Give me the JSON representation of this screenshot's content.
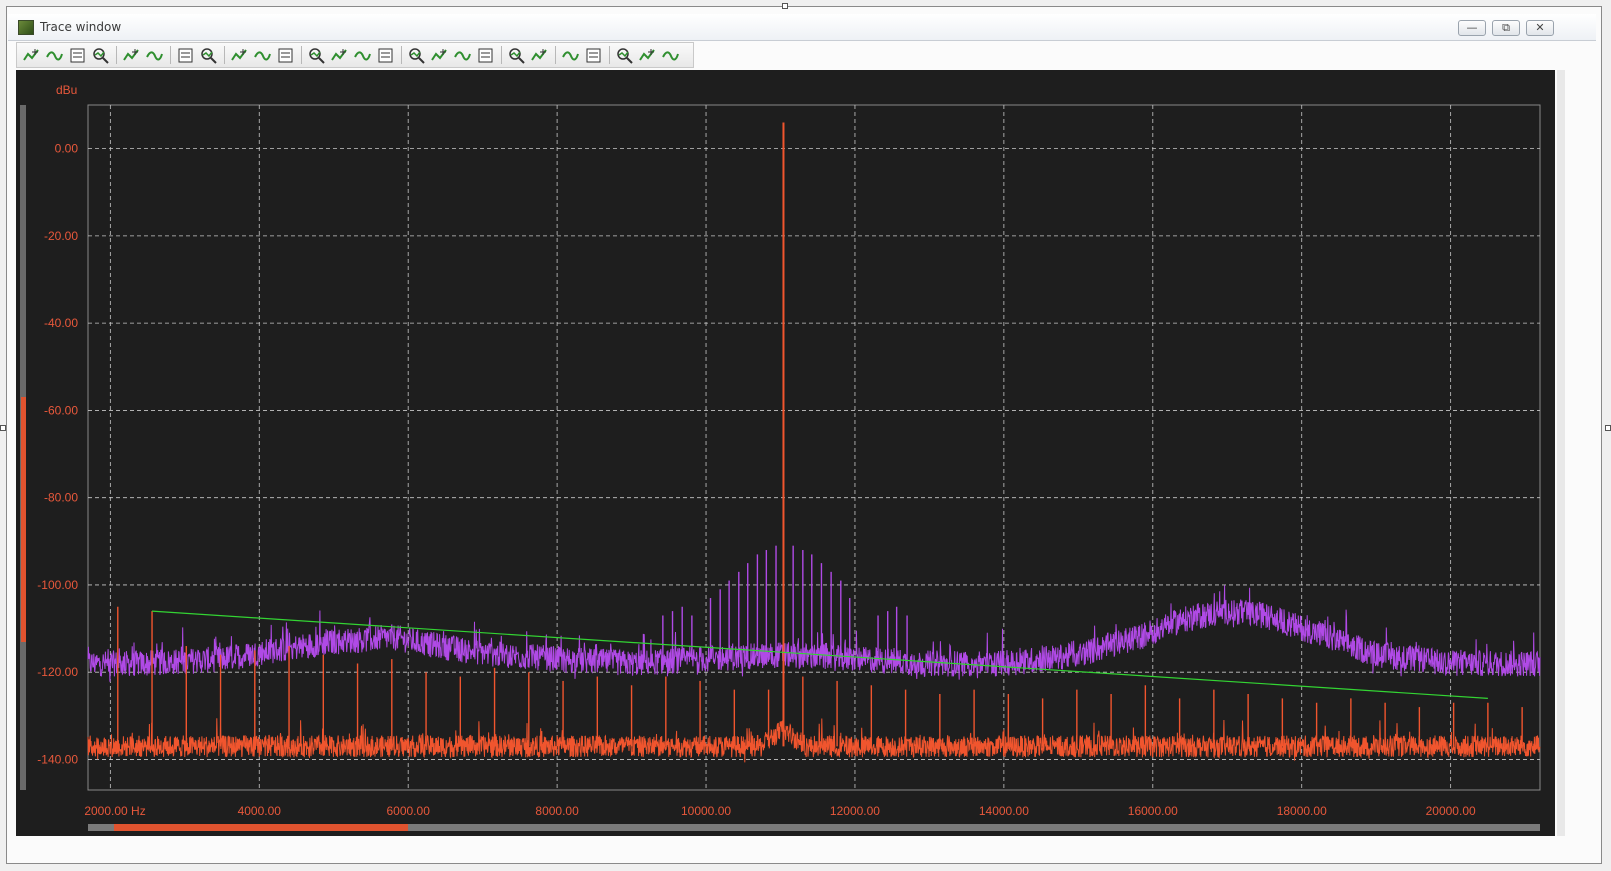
{
  "window": {
    "title": "Trace window"
  },
  "toolbar": {
    "icons": [
      "add-trace-icon",
      "wave-icon",
      "save-icon",
      "copy-icon",
      "grid-icon",
      "list-icon",
      "table-icon",
      "marker-icon",
      "zoom-in-icon",
      "zoom-out-icon",
      "fit-icon",
      "cursor-a-icon",
      "cursor-b-icon",
      "cursor-c-icon",
      "cursor-d-icon",
      "zoom-x-icon",
      "zoom-y-icon",
      "smooth-icon",
      "scale-icon",
      "peak-icon",
      "valley-icon",
      "measure-icon",
      "swap-icon",
      "hide-icon",
      "show-icon",
      "filter-icon"
    ]
  },
  "colors": {
    "background": "#1e1e1e",
    "grid": "#c8c8c8",
    "axis_text": "#e8583b",
    "trace_red": "#f0552e",
    "trace_purple": "#b04ae6",
    "trace_green": "#33d433"
  },
  "chart_data": {
    "type": "line",
    "ylabel": "dBu",
    "x_unit": "Hz",
    "xlim": [
      1700,
      21200
    ],
    "ylim": [
      -147,
      10
    ],
    "grid": true,
    "x_ticks": [
      2000,
      4000,
      6000,
      8000,
      10000,
      12000,
      14000,
      16000,
      18000,
      20000
    ],
    "x_tick_labels": [
      "2000.00 Hz",
      "4000.00",
      "6000.00",
      "8000.00",
      "10000.00",
      "12000.00",
      "14000.00",
      "16000.00",
      "18000.00",
      "20000.00"
    ],
    "y_ticks": [
      0,
      -20,
      -40,
      -60,
      -80,
      -100,
      -120,
      -140
    ],
    "y_tick_labels": [
      "0.00",
      "-20.00",
      "-40.00",
      "-60.00",
      "-80.00",
      "-100.00",
      "-120.00",
      "-140.00"
    ],
    "series": [
      {
        "color": "#f0552e",
        "noise_floor": -137,
        "peaks": [
          {
            "x": 2100,
            "y": -105
          },
          {
            "x": 2560,
            "y": -106
          },
          {
            "x": 3020,
            "y": -114
          },
          {
            "x": 3480,
            "y": -116
          },
          {
            "x": 3940,
            "y": -115
          },
          {
            "x": 4400,
            "y": -114
          },
          {
            "x": 4860,
            "y": -116
          },
          {
            "x": 5320,
            "y": -118
          },
          {
            "x": 5780,
            "y": -117
          },
          {
            "x": 6240,
            "y": -120
          },
          {
            "x": 6700,
            "y": -121
          },
          {
            "x": 7160,
            "y": -119
          },
          {
            "x": 7620,
            "y": -120
          },
          {
            "x": 8080,
            "y": -122
          },
          {
            "x": 8540,
            "y": -121
          },
          {
            "x": 9000,
            "y": -123
          },
          {
            "x": 9460,
            "y": -121
          },
          {
            "x": 9920,
            "y": -122
          },
          {
            "x": 10380,
            "y": -124
          },
          {
            "x": 10840,
            "y": -124
          },
          {
            "x": 11040,
            "y": 6
          },
          {
            "x": 11300,
            "y": -121
          },
          {
            "x": 11760,
            "y": -122
          },
          {
            "x": 12220,
            "y": -123
          },
          {
            "x": 12680,
            "y": -124
          },
          {
            "x": 13140,
            "y": -125
          },
          {
            "x": 13600,
            "y": -124
          },
          {
            "x": 14060,
            "y": -125
          },
          {
            "x": 14520,
            "y": -126
          },
          {
            "x": 14980,
            "y": -124
          },
          {
            "x": 15440,
            "y": -125
          },
          {
            "x": 15900,
            "y": -123
          },
          {
            "x": 16360,
            "y": -126
          },
          {
            "x": 16820,
            "y": -124
          },
          {
            "x": 17280,
            "y": -125
          },
          {
            "x": 17740,
            "y": -126
          },
          {
            "x": 18200,
            "y": -127
          },
          {
            "x": 18660,
            "y": -126
          },
          {
            "x": 19120,
            "y": -127
          },
          {
            "x": 19580,
            "y": -128
          },
          {
            "x": 20040,
            "y": -127
          },
          {
            "x": 20500,
            "y": -127
          },
          {
            "x": 20960,
            "y": -128
          }
        ]
      },
      {
        "color": "#b04ae6",
        "profile": [
          {
            "x": 1700,
            "y": -118
          },
          {
            "x": 2500,
            "y": -118
          },
          {
            "x": 3500,
            "y": -117
          },
          {
            "x": 4200,
            "y": -115
          },
          {
            "x": 5000,
            "y": -113
          },
          {
            "x": 5800,
            "y": -112
          },
          {
            "x": 6400,
            "y": -114
          },
          {
            "x": 7200,
            "y": -116
          },
          {
            "x": 8000,
            "y": -117
          },
          {
            "x": 9000,
            "y": -118
          },
          {
            "x": 10000,
            "y": -117
          },
          {
            "x": 11000,
            "y": -116
          },
          {
            "x": 12000,
            "y": -117
          },
          {
            "x": 13000,
            "y": -118
          },
          {
            "x": 14000,
            "y": -118
          },
          {
            "x": 15000,
            "y": -116
          },
          {
            "x": 15800,
            "y": -112
          },
          {
            "x": 16400,
            "y": -108
          },
          {
            "x": 17000,
            "y": -106
          },
          {
            "x": 17500,
            "y": -107
          },
          {
            "x": 18200,
            "y": -111
          },
          {
            "x": 19000,
            "y": -116
          },
          {
            "x": 20000,
            "y": -118
          },
          {
            "x": 21200,
            "y": -118
          }
        ],
        "sidebands": [
          {
            "x": 9420,
            "y": -107
          },
          {
            "x": 9550,
            "y": -106
          },
          {
            "x": 9680,
            "y": -105
          },
          {
            "x": 9810,
            "y": -107
          },
          {
            "x": 10060,
            "y": -103
          },
          {
            "x": 10190,
            "y": -101
          },
          {
            "x": 10310,
            "y": -99
          },
          {
            "x": 10440,
            "y": -97
          },
          {
            "x": 10560,
            "y": -95
          },
          {
            "x": 10690,
            "y": -93
          },
          {
            "x": 10810,
            "y": -92
          },
          {
            "x": 10940,
            "y": -91
          },
          {
            "x": 11170,
            "y": -91
          },
          {
            "x": 11300,
            "y": -92
          },
          {
            "x": 11420,
            "y": -93
          },
          {
            "x": 11550,
            "y": -95
          },
          {
            "x": 11680,
            "y": -97
          },
          {
            "x": 11810,
            "y": -99
          },
          {
            "x": 11930,
            "y": -103
          },
          {
            "x": 12310,
            "y": -107
          },
          {
            "x": 12440,
            "y": -106
          },
          {
            "x": 12560,
            "y": -105
          },
          {
            "x": 12700,
            "y": -107
          }
        ]
      },
      {
        "color": "#33d433",
        "points": [
          {
            "x": 2560,
            "y": -106
          },
          {
            "x": 20500,
            "y": -126
          }
        ]
      }
    ]
  }
}
